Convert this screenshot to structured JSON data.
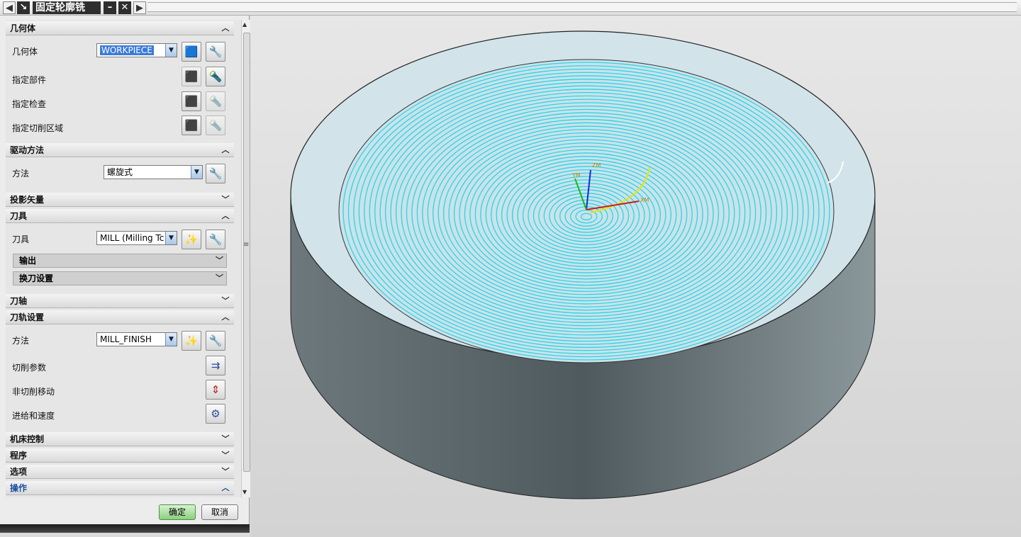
{
  "window": {
    "title": "固定轮廓铣",
    "nav_back": "◀",
    "nav_fwd": "▶",
    "pin": "↘",
    "minimize": "–",
    "close": "✕"
  },
  "sections": {
    "geometry": {
      "header": "几何体",
      "geometry_label": "几何体",
      "geometry_value": "WORKPIECE",
      "specify_part": "指定部件",
      "specify_check": "指定检查",
      "specify_cut_area": "指定切削区域"
    },
    "drive": {
      "header": "驱动方法",
      "method_label": "方法",
      "method_value": "螺旋式"
    },
    "projection": {
      "header": "投影矢量"
    },
    "tool": {
      "header": "刀具",
      "tool_label": "刀具",
      "tool_value": "MILL (Milling Tc",
      "output": "输出",
      "tool_change": "换刀设置"
    },
    "axis": {
      "header": "刀轴"
    },
    "path": {
      "header": "刀轨设置",
      "method_label": "方法",
      "method_value": "MILL_FINISH",
      "cut_params": "切削参数",
      "non_cut": "非切削移动",
      "feeds": "进给和速度"
    },
    "machine": {
      "header": "机床控制"
    },
    "program": {
      "header": "程序"
    },
    "options": {
      "header": "选项"
    },
    "operation": {
      "header": "操作"
    }
  },
  "footer": {
    "ok": "确定",
    "cancel": "取消"
  },
  "viewport": {
    "axis_labels": {
      "z": "ZM",
      "y": "YM",
      "x": "XM"
    },
    "colors": {
      "toolpath": "#2fd3e6",
      "part_top": "#d2e4ea",
      "part_side": "#5f6b70"
    }
  }
}
